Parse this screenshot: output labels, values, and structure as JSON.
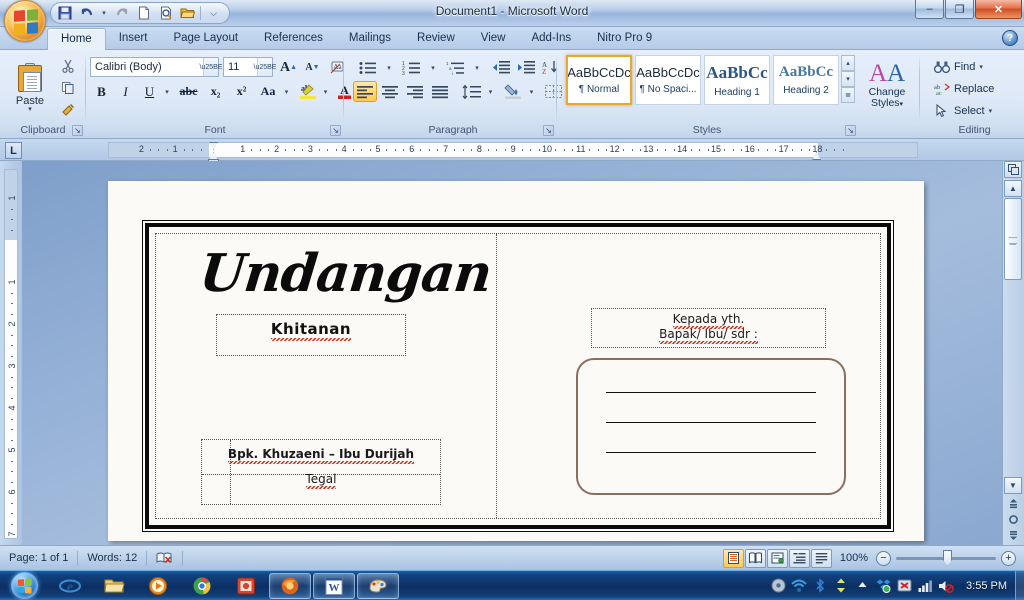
{
  "window": {
    "title": "Document1 - Microsoft Word",
    "minimize_label": "–",
    "restore_label": "❐",
    "close_label": "✕"
  },
  "office_button": {
    "name": "Office Button"
  },
  "quick_access": {
    "items": [
      {
        "name": "save-icon",
        "label": "Save",
        "glyph": "▣"
      },
      {
        "name": "undo-icon",
        "label": "Undo",
        "glyph": "↶"
      },
      {
        "name": "undo-dropdown-icon",
        "label": "Undo options",
        "glyph": "▾"
      },
      {
        "name": "redo-icon",
        "label": "Redo",
        "glyph": "↷"
      },
      {
        "name": "new-icon",
        "label": "New",
        "glyph": "▯"
      },
      {
        "name": "print-preview-icon",
        "label": "Print Preview",
        "glyph": "⌕"
      },
      {
        "name": "open-icon",
        "label": "Open",
        "glyph": "▱"
      },
      {
        "name": "customize-qat-icon",
        "label": "Customize Quick Access Toolbar",
        "glyph": "⌵"
      }
    ]
  },
  "ribbon": {
    "tabs": [
      {
        "label": "Home",
        "active": true
      },
      {
        "label": "Insert",
        "active": false
      },
      {
        "label": "Page Layout",
        "active": false
      },
      {
        "label": "References",
        "active": false
      },
      {
        "label": "Mailings",
        "active": false
      },
      {
        "label": "Review",
        "active": false
      },
      {
        "label": "View",
        "active": false
      },
      {
        "label": "Add-Ins",
        "active": false
      },
      {
        "label": "Nitro Pro 9",
        "active": false
      }
    ],
    "help_label": "?",
    "groups": {
      "clipboard": {
        "label": "Clipboard",
        "paste_label": "Paste",
        "paste_arrow": "▾",
        "cut_label": "Cut",
        "copy_label": "Copy",
        "format_painter_label": "Format Painter",
        "dialog_launcher": "↘"
      },
      "font": {
        "label": "Font",
        "font_name": "Calibri (Body)",
        "font_size": "11",
        "grow_font": "A",
        "shrink_font": "A",
        "clear_formatting": "Aa",
        "bold": "B",
        "italic": "I",
        "underline": "U",
        "strikethrough": "abc",
        "subscript": "x₂",
        "superscript": "x²",
        "change_case": "Aa",
        "highlight": "ab",
        "font_color": "A",
        "dialog_launcher": "↘"
      },
      "paragraph": {
        "label": "Paragraph",
        "bullets": "☰",
        "numbering": "☰",
        "multilevel": "☰",
        "decrease_indent": "⮜",
        "increase_indent": "⮞",
        "sort": "AZ↓",
        "show_marks": "¶",
        "align_left": "≡",
        "align_center": "≡",
        "align_right": "≡",
        "justify": "≡",
        "line_spacing": "↕",
        "shading": "▣",
        "borders": "▦",
        "dialog_launcher": "↘"
      },
      "styles": {
        "label": "Styles",
        "items": [
          {
            "preview": "AaBbCcDc",
            "name": "¶ Normal",
            "selected": true,
            "variant": "normal"
          },
          {
            "preview": "AaBbCcDc",
            "name": "¶ No Spaci...",
            "selected": false,
            "variant": "normal"
          },
          {
            "preview": "AaBbCс",
            "name": "Heading 1",
            "selected": false,
            "variant": "h1"
          },
          {
            "preview": "AaBbCc",
            "name": "Heading 2",
            "selected": false,
            "variant": "h2"
          }
        ],
        "scroll_up": "▴",
        "scroll_down": "▾",
        "more": "≣",
        "change_styles_label": "Change\nStyles",
        "change_styles_line1": "Change",
        "change_styles_line2": "Styles",
        "change_styles_arrow": "▾",
        "dialog_launcher": "↘"
      },
      "editing": {
        "label": "Editing",
        "items": [
          {
            "label": "Find",
            "icon": "binoculars-icon",
            "glyph": "🔍",
            "arrow": "▾"
          },
          {
            "label": "Replace",
            "icon": "replace-icon",
            "glyph": "ab",
            "arrow": ""
          },
          {
            "label": "Select",
            "icon": "select-arrow-icon",
            "glyph": "↖",
            "arrow": "▾"
          }
        ]
      }
    }
  },
  "ruler": {
    "tab_selector": "L",
    "horizontal_labels": [
      "2",
      "1",
      "1",
      "2",
      "3",
      "4",
      "5",
      "6",
      "7",
      "8",
      "9",
      "10",
      "11",
      "12",
      "13",
      "14",
      "15",
      "16",
      "17",
      "18"
    ],
    "vertical_labels": [
      "2",
      "1",
      "1",
      "2",
      "3",
      "4",
      "5",
      "6",
      "7"
    ]
  },
  "document": {
    "title_script": "Undangan",
    "heading_khitanan": "Khitanan",
    "parents_line": "Bpk. Khuzaeni – Ibu Durijah",
    "city": "Tegal",
    "recipient_line1": "Kepada yth.",
    "recipient_line2": "Bapak/ Ibu/ sdr :"
  },
  "status_bar": {
    "page_label": "Page: 1 of 1",
    "words_label": "Words: 12",
    "proofing_icon": "proofing-errors-icon",
    "proofing_glyph": "📖",
    "zoom_label": "100%",
    "zoom_out": "−",
    "zoom_in": "+",
    "views": [
      {
        "name": "print-layout-view",
        "glyph": "▤",
        "active": true
      },
      {
        "name": "full-screen-reading-view",
        "glyph": "▧",
        "active": false
      },
      {
        "name": "web-layout-view",
        "glyph": "▥",
        "active": false
      },
      {
        "name": "outline-view",
        "glyph": "≣",
        "active": false
      },
      {
        "name": "draft-view",
        "glyph": "≡",
        "active": false
      }
    ]
  },
  "scrollbar": {
    "split_icon": "▔",
    "up_arrow": "▲",
    "down_arrow": "▼",
    "previous_page": "⏫",
    "select_browse_object": "○",
    "next_page": "⏬"
  },
  "taskbar": {
    "start_label": "Start",
    "items": [
      {
        "name": "taskbar-internet-explorer",
        "glyph": "e",
        "open": false,
        "color": "#2e7fd0"
      },
      {
        "name": "taskbar-windows-explorer",
        "glyph": "🗀",
        "open": false,
        "color": "#e0b63a"
      },
      {
        "name": "taskbar-windows-media-player",
        "glyph": "▶",
        "open": false,
        "color": "#e07c1e"
      },
      {
        "name": "taskbar-google-chrome",
        "glyph": "◉",
        "open": false,
        "color": "#2b9b4a"
      },
      {
        "name": "taskbar-app-red",
        "glyph": "▣",
        "open": false,
        "color": "#d24a2e"
      },
      {
        "name": "taskbar-mozilla-firefox",
        "glyph": "🦊",
        "open": true,
        "color": "#e8701a"
      },
      {
        "name": "taskbar-microsoft-word",
        "glyph": "W",
        "open": true,
        "color": "#2b579a"
      },
      {
        "name": "taskbar-paint",
        "glyph": "🎨",
        "open": true,
        "color": "#c8a02e"
      }
    ],
    "tray": [
      {
        "name": "tray-disc-icon",
        "glyph": "◎"
      },
      {
        "name": "tray-wireless-icon",
        "glyph": "◠"
      },
      {
        "name": "tray-bluetooth-icon",
        "glyph": "✶"
      },
      {
        "name": "tray-updown-icon",
        "glyph": "⇅"
      },
      {
        "name": "tray-show-hidden-icons",
        "glyph": "▲"
      },
      {
        "name": "tray-dropbox-icon",
        "glyph": "❖"
      },
      {
        "name": "tray-antivirus-icon",
        "glyph": "☣"
      },
      {
        "name": "tray-network-signal-icon",
        "glyph": "▆"
      },
      {
        "name": "tray-volume-muted-icon",
        "glyph": "🔇"
      }
    ],
    "clock": "3:55 PM"
  }
}
